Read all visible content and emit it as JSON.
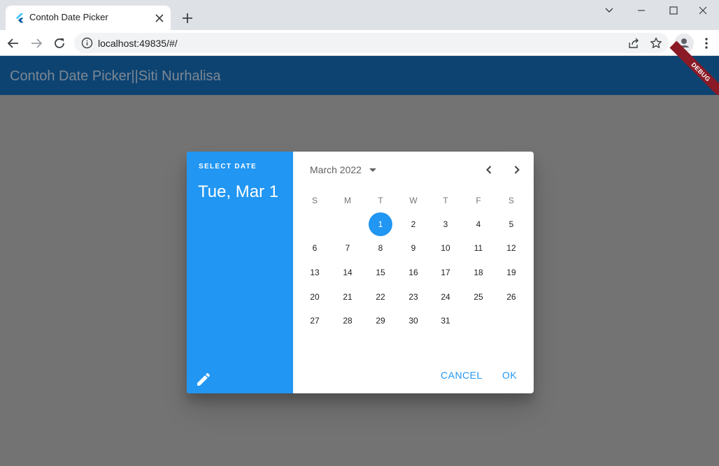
{
  "browser": {
    "tab_title": "Contoh Date Picker",
    "url": "localhost:49835/#/"
  },
  "app": {
    "title": "Contoh Date Picker||Siti Nurhalisa",
    "debug_banner": "DEBUG",
    "appbar_color": "#0d4371",
    "accent_color": "#2196f3"
  },
  "date_picker": {
    "help_text": "SELECT DATE",
    "selected_date": "Tue, Mar 1",
    "month_year": "March 2022",
    "weekdays": [
      "S",
      "M",
      "T",
      "W",
      "T",
      "F",
      "S"
    ],
    "selected_day": "1",
    "days": [
      "1",
      "2",
      "3",
      "4",
      "5",
      "6",
      "7",
      "8",
      "9",
      "10",
      "11",
      "12",
      "13",
      "14",
      "15",
      "16",
      "17",
      "18",
      "19",
      "20",
      "21",
      "22",
      "23",
      "24",
      "25",
      "26",
      "27",
      "28",
      "29",
      "30",
      "31"
    ],
    "cancel_label": "CANCEL",
    "ok_label": "OK"
  },
  "icons": {
    "favicon": "flutter-icon",
    "edit": "pencil-icon",
    "prev": "chevron-left-icon",
    "next": "chevron-right-icon",
    "month_dropdown": "caret-down-icon"
  }
}
